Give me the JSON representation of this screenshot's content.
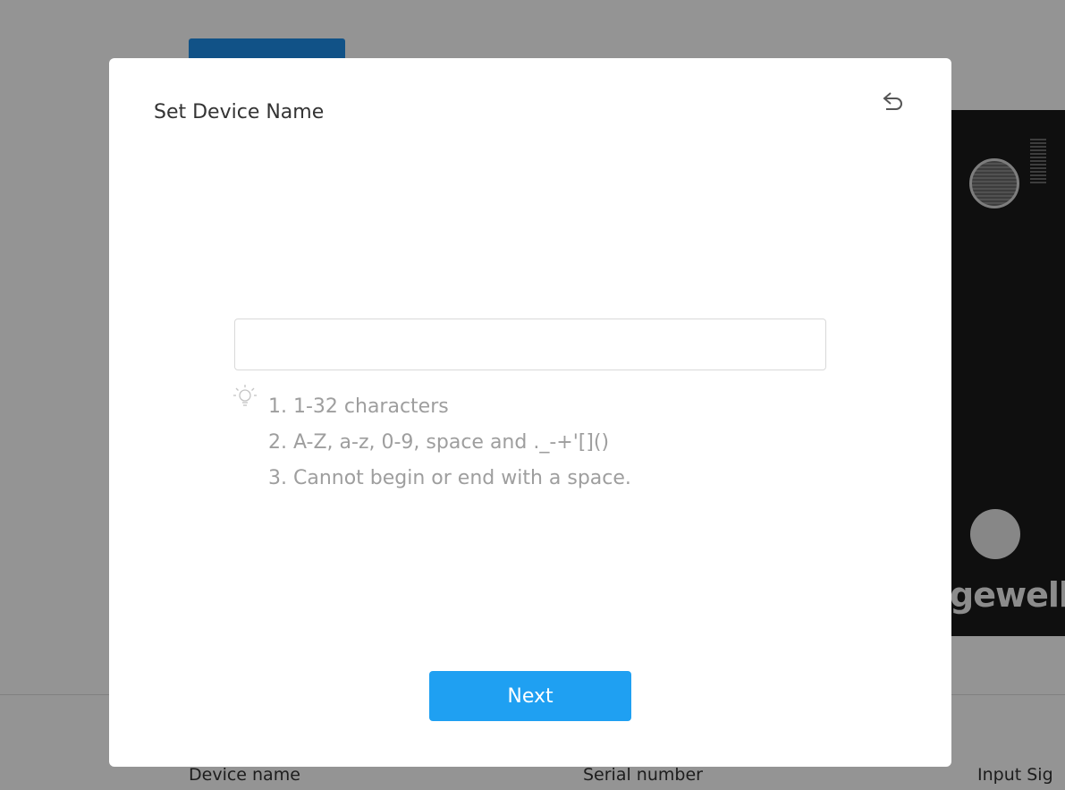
{
  "background": {
    "device_brand": "gewell",
    "columns": [
      "Device name",
      "Serial number",
      "Input Sig"
    ]
  },
  "modal": {
    "title": "Set Device Name",
    "back_icon": "undo-arrow-icon",
    "input": {
      "value": "",
      "placeholder": ""
    },
    "hint_icon": "lightbulb-icon",
    "hints": [
      "1. 1-32 characters",
      "2. A-Z, a-z, 0-9, space and ._-+'[]()",
      "3. Cannot begin or end with a space."
    ],
    "next_label": "Next"
  },
  "colors": {
    "primary": "#1fa0f2",
    "overlay": "rgba(0,0,0,0.42)",
    "hint_text": "#9e9e9e"
  }
}
